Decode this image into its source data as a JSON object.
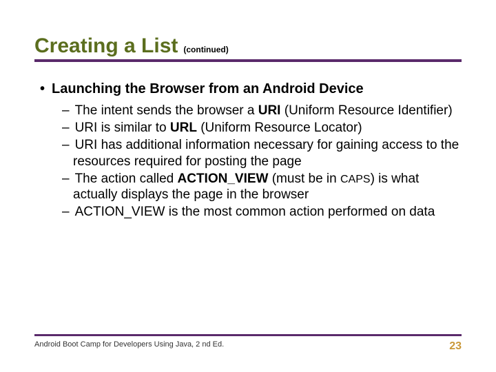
{
  "title": {
    "main": "Creating a List",
    "sub": "(continued)"
  },
  "heading": "Launching the Browser from an Android Device",
  "items": {
    "i0a": "The intent sends the browser a ",
    "i0b": "URI",
    "i0c": " (Uniform Resource Identifier)",
    "i1a": "URI is similar to ",
    "i1b": "URL",
    "i1c": " (Uniform Resource Locator)",
    "i2": "URI has additional information necessary for gaining access to the resources required for posting the page",
    "i3a": "The action called ",
    "i3b": "ACTION_VIEW",
    "i3c": " (must be in ",
    "i3d": "CAPS",
    "i3e": ") is what actually displays the page in the browser",
    "i4": "ACTION_VIEW is the most common action performed on data"
  },
  "footer": {
    "text": "Android Boot Camp for Developers Using Java, 2 nd Ed.",
    "page": "23"
  }
}
